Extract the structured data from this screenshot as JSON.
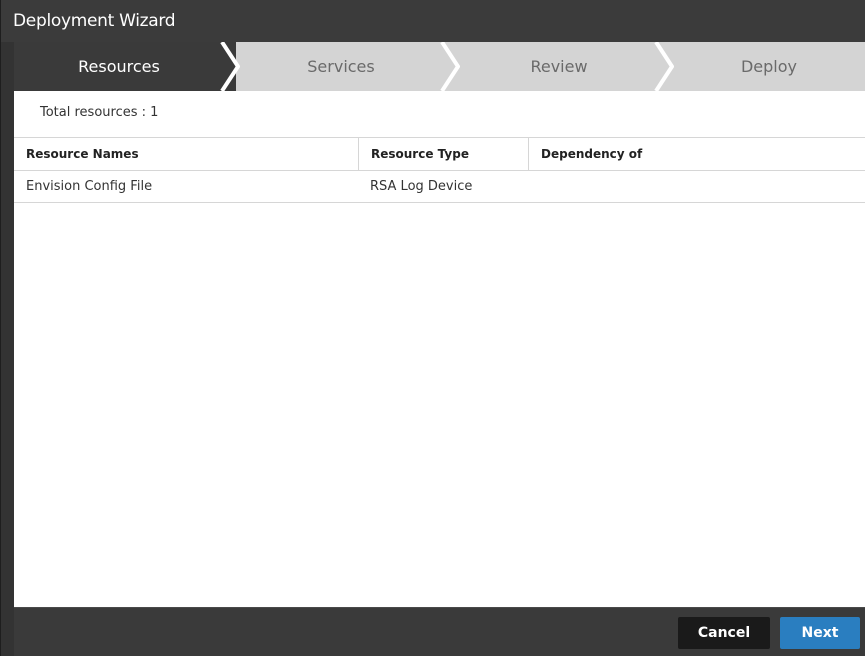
{
  "window": {
    "title": "Deployment Wizard"
  },
  "steps": [
    {
      "label": "Resources",
      "active": true
    },
    {
      "label": "Services",
      "active": false
    },
    {
      "label": "Review",
      "active": false
    },
    {
      "label": "Deploy",
      "active": false
    }
  ],
  "summary": {
    "total_text": "Total resources : 1"
  },
  "table": {
    "columns": [
      "Resource Names",
      "Resource Type",
      "Dependency of"
    ],
    "rows": [
      [
        "Envision Config File",
        "RSA Log Device",
        ""
      ]
    ]
  },
  "footer": {
    "cancel_label": "Cancel",
    "next_label": "Next"
  },
  "colors": {
    "accent": "#2a7ec0",
    "active_step": "#3a3a3a",
    "inactive_step": "#d4d4d4"
  }
}
